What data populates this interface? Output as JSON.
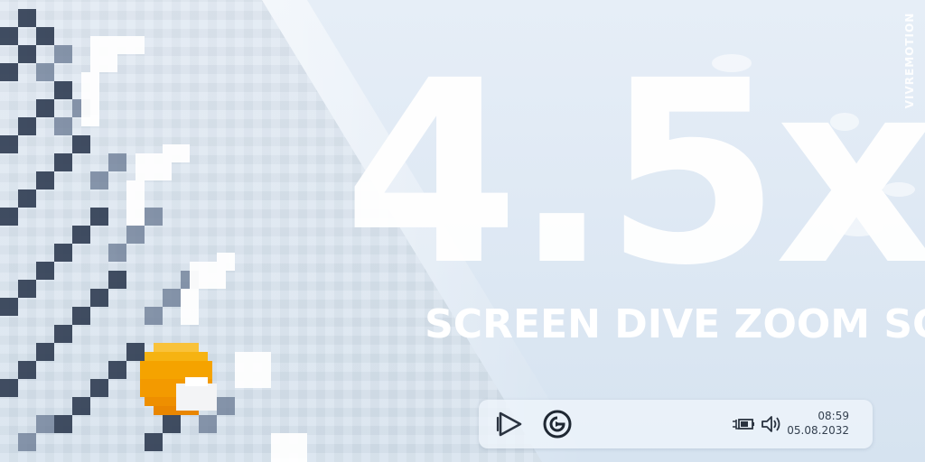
{
  "overlay": {
    "zoom_factor": "4.5x",
    "ticker_text": "M SCREEN DIVE ZOOM SCR",
    "watermark": "VIVREMOTION"
  },
  "taskbar": {
    "apps": [
      {
        "name": "Media player",
        "icon": "play-triangle-icon"
      },
      {
        "name": "Elgato app",
        "icon": "elgato-logo-icon"
      }
    ],
    "tray": [
      {
        "name": "Battery charging",
        "icon": "battery-charging-icon"
      },
      {
        "name": "Volume",
        "icon": "speaker-volume-icon"
      }
    ],
    "time": "08:59",
    "date": "05.08.2032"
  },
  "colors": {
    "background": "#dfe9f4",
    "text_main": "#ffffff",
    "taskbar": "#eef5fb",
    "icon_dark": "#2a3340",
    "sun_orange": "#f5a300"
  }
}
